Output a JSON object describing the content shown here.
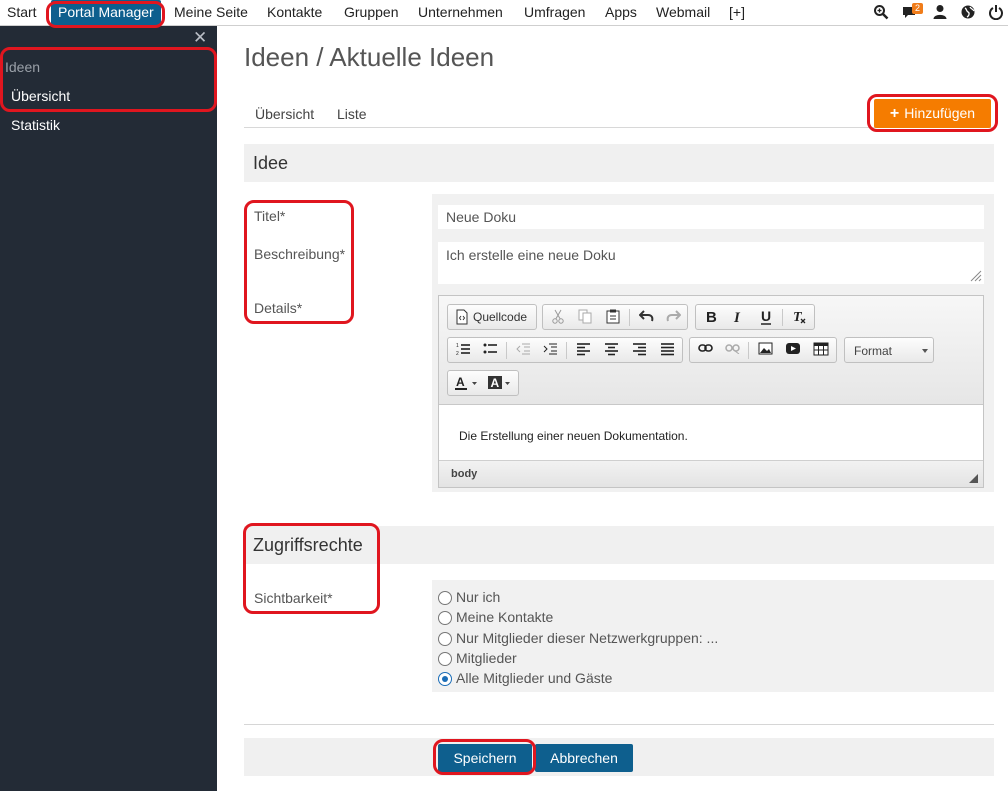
{
  "topnav": {
    "items": [
      "Start",
      "Portal Manager",
      "Meine Seite",
      "Kontakte",
      "Gruppen",
      "Unternehmen",
      "Umfragen",
      "Apps",
      "Webmail",
      "[+]"
    ],
    "notification_count": "2",
    "icons": [
      "search-zoom-icon",
      "chat-notification-icon",
      "user-icon",
      "globe-icon",
      "power-icon"
    ]
  },
  "sidebar": {
    "heading": "Ideen",
    "items": [
      "Übersicht",
      "Statistik"
    ],
    "close_glyph": "✕"
  },
  "main": {
    "title": "Ideen / Aktuelle Ideen",
    "tabs": [
      "Übersicht",
      "Liste"
    ],
    "add_button": {
      "plus": "+",
      "label": "Hinzufügen"
    },
    "section_idea": "Idee",
    "labels": {
      "title": "Titel*",
      "description": "Beschreibung*",
      "details": "Details*"
    },
    "title_value": "Neue Doku",
    "description_value": "Ich erstelle eine neue Doku",
    "editor": {
      "source_label": "Quellcode",
      "format_label": "Format",
      "content": "Die Erstellung einer neuen Dokumentation.",
      "status_path": "body"
    },
    "section_access": "Zugriffsrechte",
    "visibility_label": "Sichtbarkeit*",
    "visibility_options": [
      "Nur ich",
      "Meine Kontakte",
      "Nur Mitglieder dieser Netzwerkgruppen: ...",
      "Mitglieder",
      "Alle Mitglieder und Gäste"
    ],
    "visibility_selected": "Alle Mitglieder und Gäste",
    "save_button": "Speichern",
    "cancel_button": "Abbrechen"
  },
  "colors": {
    "nav_active": "#0e5f8e",
    "sidebar_bg": "#232b36",
    "accent_orange": "#f57c00",
    "highlight_red": "#e0161f",
    "button_blue": "#0e5f8e"
  }
}
